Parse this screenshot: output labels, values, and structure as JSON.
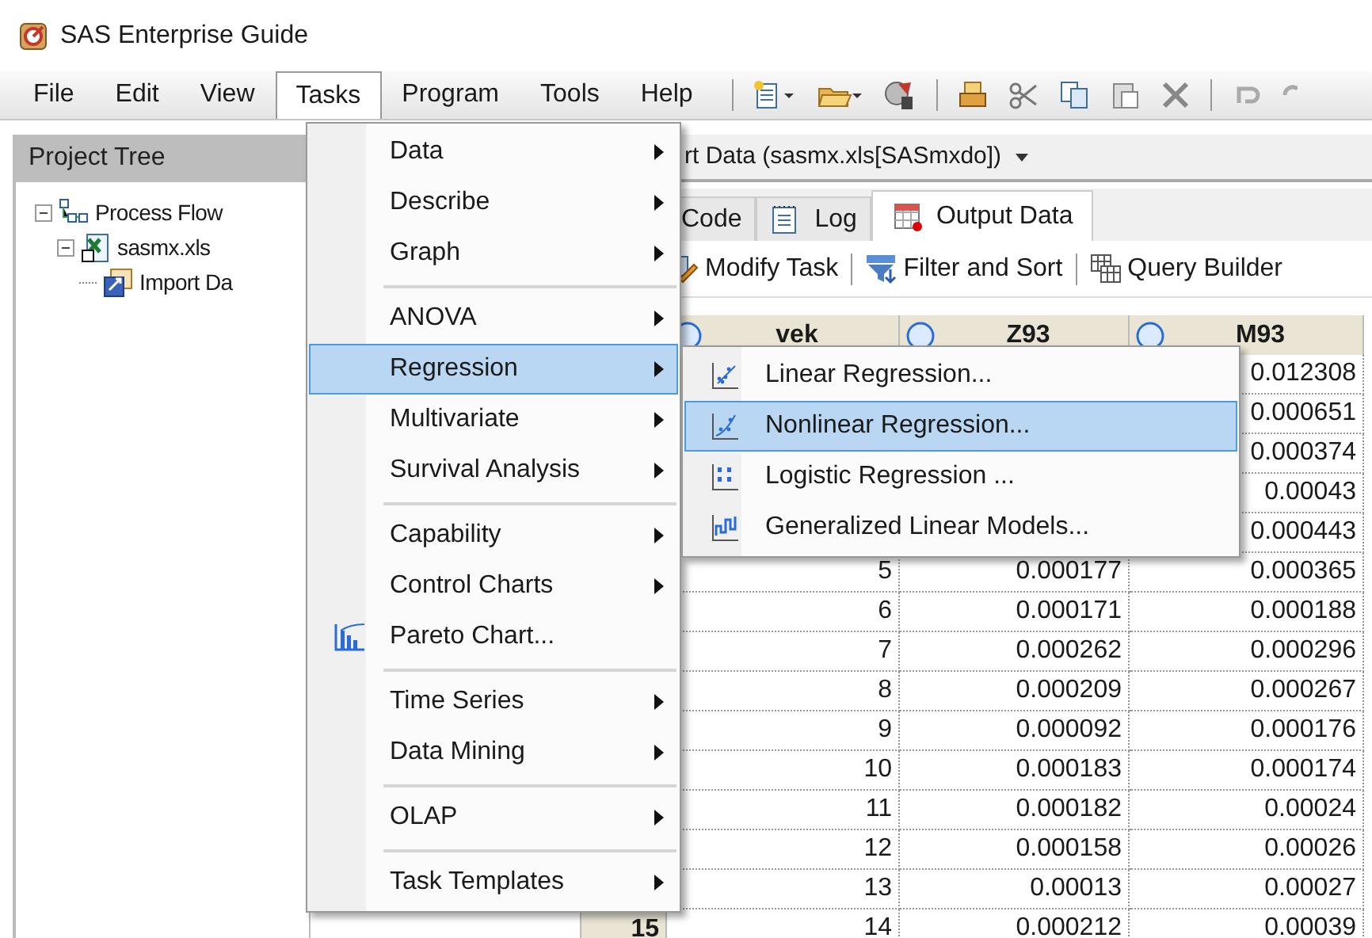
{
  "window": {
    "title": "SAS Enterprise Guide"
  },
  "menubar": [
    {
      "label": "File",
      "selected": false
    },
    {
      "label": "Edit",
      "selected": false
    },
    {
      "label": "View",
      "selected": false
    },
    {
      "label": "Tasks",
      "selected": true
    },
    {
      "label": "Program",
      "selected": false
    },
    {
      "label": "Tools",
      "selected": false
    },
    {
      "label": "Help",
      "selected": false
    }
  ],
  "project_tree": {
    "title": "Project Tree",
    "items": [
      {
        "label": "Process Flow",
        "kind": "flow",
        "expanded": true,
        "children": [
          {
            "label": "sasmx.xls",
            "kind": "excel",
            "expanded": true,
            "children": [
              {
                "label": "Import Da",
                "kind": "import"
              }
            ]
          }
        ]
      }
    ]
  },
  "document": {
    "title": "rt Data (sasmx.xls[SASmxdo])",
    "tabs": [
      {
        "label": "Code",
        "selected": false
      },
      {
        "label": "Log",
        "selected": false
      },
      {
        "label": "Output Data",
        "selected": true
      }
    ],
    "toolbar": [
      "Modify Task",
      "Filter and Sort",
      "Query Builder"
    ],
    "table": {
      "columns": [
        "vek",
        "Z93",
        "M93"
      ],
      "rows": [
        {
          "m93": "0.012308"
        },
        {
          "m93": "0.000651"
        },
        {
          "m93": "0.000374"
        },
        {
          "m93": "0.00043"
        },
        {
          "m93": "0.000443"
        },
        {
          "vek": "5",
          "z93": "0.000177",
          "m93": "0.000365"
        },
        {
          "vek": "6",
          "z93": "0.000171",
          "m93": "0.000188"
        },
        {
          "vek": "7",
          "z93": "0.000262",
          "m93": "0.000296"
        },
        {
          "vek": "8",
          "z93": "0.000209",
          "m93": "0.000267"
        },
        {
          "vek": "9",
          "z93": "0.000092",
          "m93": "0.000176"
        },
        {
          "vek": "10",
          "z93": "0.000183",
          "m93": "0.000174"
        },
        {
          "vek": "11",
          "z93": "0.000182",
          "m93": "0.00024"
        },
        {
          "vek": "12",
          "z93": "0.000158",
          "m93": "0.00026"
        },
        {
          "vek": "13",
          "z93": "0.00013",
          "m93": "0.00027"
        },
        {
          "row_header": "15",
          "vek": "14",
          "z93": "0.000212",
          "m93": "0.00039"
        }
      ]
    }
  },
  "tasks_menu": [
    {
      "kind": "item",
      "label": "Data",
      "submenu": true,
      "selected": false
    },
    {
      "kind": "item",
      "label": "Describe",
      "submenu": true,
      "selected": false
    },
    {
      "kind": "item",
      "label": "Graph",
      "submenu": true,
      "selected": false
    },
    {
      "kind": "separator"
    },
    {
      "kind": "item",
      "label": "ANOVA",
      "submenu": true,
      "selected": false
    },
    {
      "kind": "item",
      "label": "Regression",
      "submenu": true,
      "selected": true
    },
    {
      "kind": "item",
      "label": "Multivariate",
      "submenu": true,
      "selected": false
    },
    {
      "kind": "item",
      "label": "Survival Analysis",
      "submenu": true,
      "selected": false
    },
    {
      "kind": "separator"
    },
    {
      "kind": "item",
      "label": "Capability",
      "submenu": true,
      "selected": false
    },
    {
      "kind": "item",
      "label": "Control Charts",
      "submenu": true,
      "selected": false
    },
    {
      "kind": "chart_item",
      "label": "Pareto Chart...",
      "submenu": false,
      "selected": false
    },
    {
      "kind": "separator"
    },
    {
      "kind": "item",
      "label": "Time Series",
      "submenu": true,
      "selected": false
    },
    {
      "kind": "item",
      "label": "Data Mining",
      "submenu": true,
      "selected": false
    },
    {
      "kind": "separator"
    },
    {
      "kind": "item",
      "label": "OLAP",
      "submenu": true,
      "selected": false
    },
    {
      "kind": "separator"
    },
    {
      "kind": "item",
      "label": "Task Templates",
      "submenu": true,
      "selected": false
    }
  ],
  "regression_submenu": [
    {
      "label": "Linear Regression...",
      "selected": false
    },
    {
      "label": "Nonlinear Regression...",
      "selected": true
    },
    {
      "label": "Logistic Regression ...",
      "selected": false
    },
    {
      "label": "Generalized Linear Models...",
      "selected": false
    }
  ]
}
